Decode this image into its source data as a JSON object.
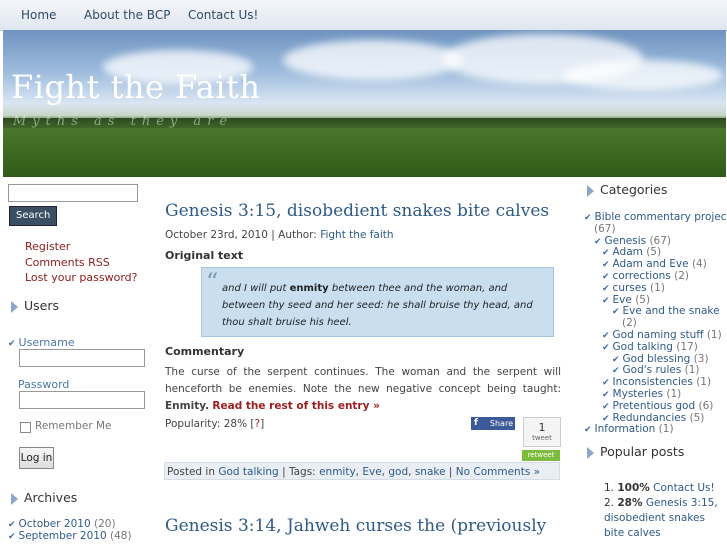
{
  "nav": {
    "items": [
      "Home",
      "About the BCP",
      "Contact Us!"
    ]
  },
  "header": {
    "title": "Fight the Faith",
    "tagline": "Myths as they are"
  },
  "search": {
    "button": "Search",
    "placeholder": ""
  },
  "links": {
    "register": "Register",
    "comments_rss": "Comments RSS",
    "lost_password": "Lost your password?"
  },
  "users_widget": {
    "title": "Users",
    "username_label": "Username",
    "password_label": "Password",
    "remember_label": "Remember Me",
    "login_button": "Log in"
  },
  "archives": {
    "title": "Archives",
    "items": [
      {
        "label": "October 2010",
        "count": "(20)"
      },
      {
        "label": "September 2010",
        "count": "(48)"
      }
    ]
  },
  "post": {
    "title": "Genesis 3:15, disobedient snakes bite calves",
    "date": "October 23rd, 2010",
    "author_prefix": "| Author:",
    "author": "Fight the faith",
    "original_heading": "Original text",
    "quote_pre": "and I will put",
    "quote_bold": "enmity",
    "quote_post": "between thee and the woman, and between thy seed and her seed: he shall bruise thy head, and thou shalt bruise his heel.",
    "commentary_heading": "Commentary",
    "commentary_text": "The curse of the serpent continues. The woman and the serpent will henceforth be enemies. Note the new negative concept being taught:",
    "commentary_bold": "Enmity.",
    "read_more": "Read the rest of this entry »",
    "popularity_label": "Popularity: 28% [",
    "popularity_help": "?",
    "popularity_close": "]",
    "share_label": "Share",
    "tweet_count": "1",
    "tweet_label": "tweet",
    "retweet_label": "retweet",
    "posted_in_label": "Posted in",
    "category": "God talking",
    "tags_label": "| Tags:",
    "tags": [
      "enmity",
      "Eve",
      "god",
      "snake"
    ],
    "comments": "No Comments »"
  },
  "next_post": {
    "title": "Genesis 3:14, Jahweh curses the (previously"
  },
  "categories": {
    "title": "Categories",
    "items": [
      {
        "label": "Bible commentary project",
        "count": "",
        "level": 0
      },
      {
        "label": "",
        "count": "(67)",
        "level": 0
      },
      {
        "label": "Genesis",
        "count": "(67)",
        "level": 1
      },
      {
        "label": "Adam",
        "count": "(5)",
        "level": 2
      },
      {
        "label": "Adam and Eve",
        "count": "(4)",
        "level": 2
      },
      {
        "label": "corrections",
        "count": "(2)",
        "level": 2
      },
      {
        "label": "curses",
        "count": "(1)",
        "level": 2
      },
      {
        "label": "Eve",
        "count": "(5)",
        "level": 2
      },
      {
        "label": "Eve and the snake",
        "count": "",
        "level": 3
      },
      {
        "label": "",
        "count": "(2)",
        "level": 3
      },
      {
        "label": "God naming stuff",
        "count": "(1)",
        "level": 2
      },
      {
        "label": "God talking",
        "count": "(17)",
        "level": 2
      },
      {
        "label": "God blessing",
        "count": "(3)",
        "level": 3
      },
      {
        "label": "God's rules",
        "count": "(1)",
        "level": 3
      },
      {
        "label": "Inconsistencies",
        "count": "(1)",
        "level": 2
      },
      {
        "label": "Mysteries",
        "count": "(1)",
        "level": 2
      },
      {
        "label": "Pretentious god",
        "count": "(6)",
        "level": 2
      },
      {
        "label": "Redundancies",
        "count": "(5)",
        "level": 2
      },
      {
        "label": "Information",
        "count": "(1)",
        "level": 0
      }
    ]
  },
  "popular": {
    "title": "Popular posts",
    "items": [
      {
        "rank": "1.",
        "pct": "100%",
        "link": "Contact Us!"
      },
      {
        "rank": "2.",
        "pct": "28%",
        "link": "Genesis 3:15, disobedient snakes bite calves"
      }
    ]
  }
}
